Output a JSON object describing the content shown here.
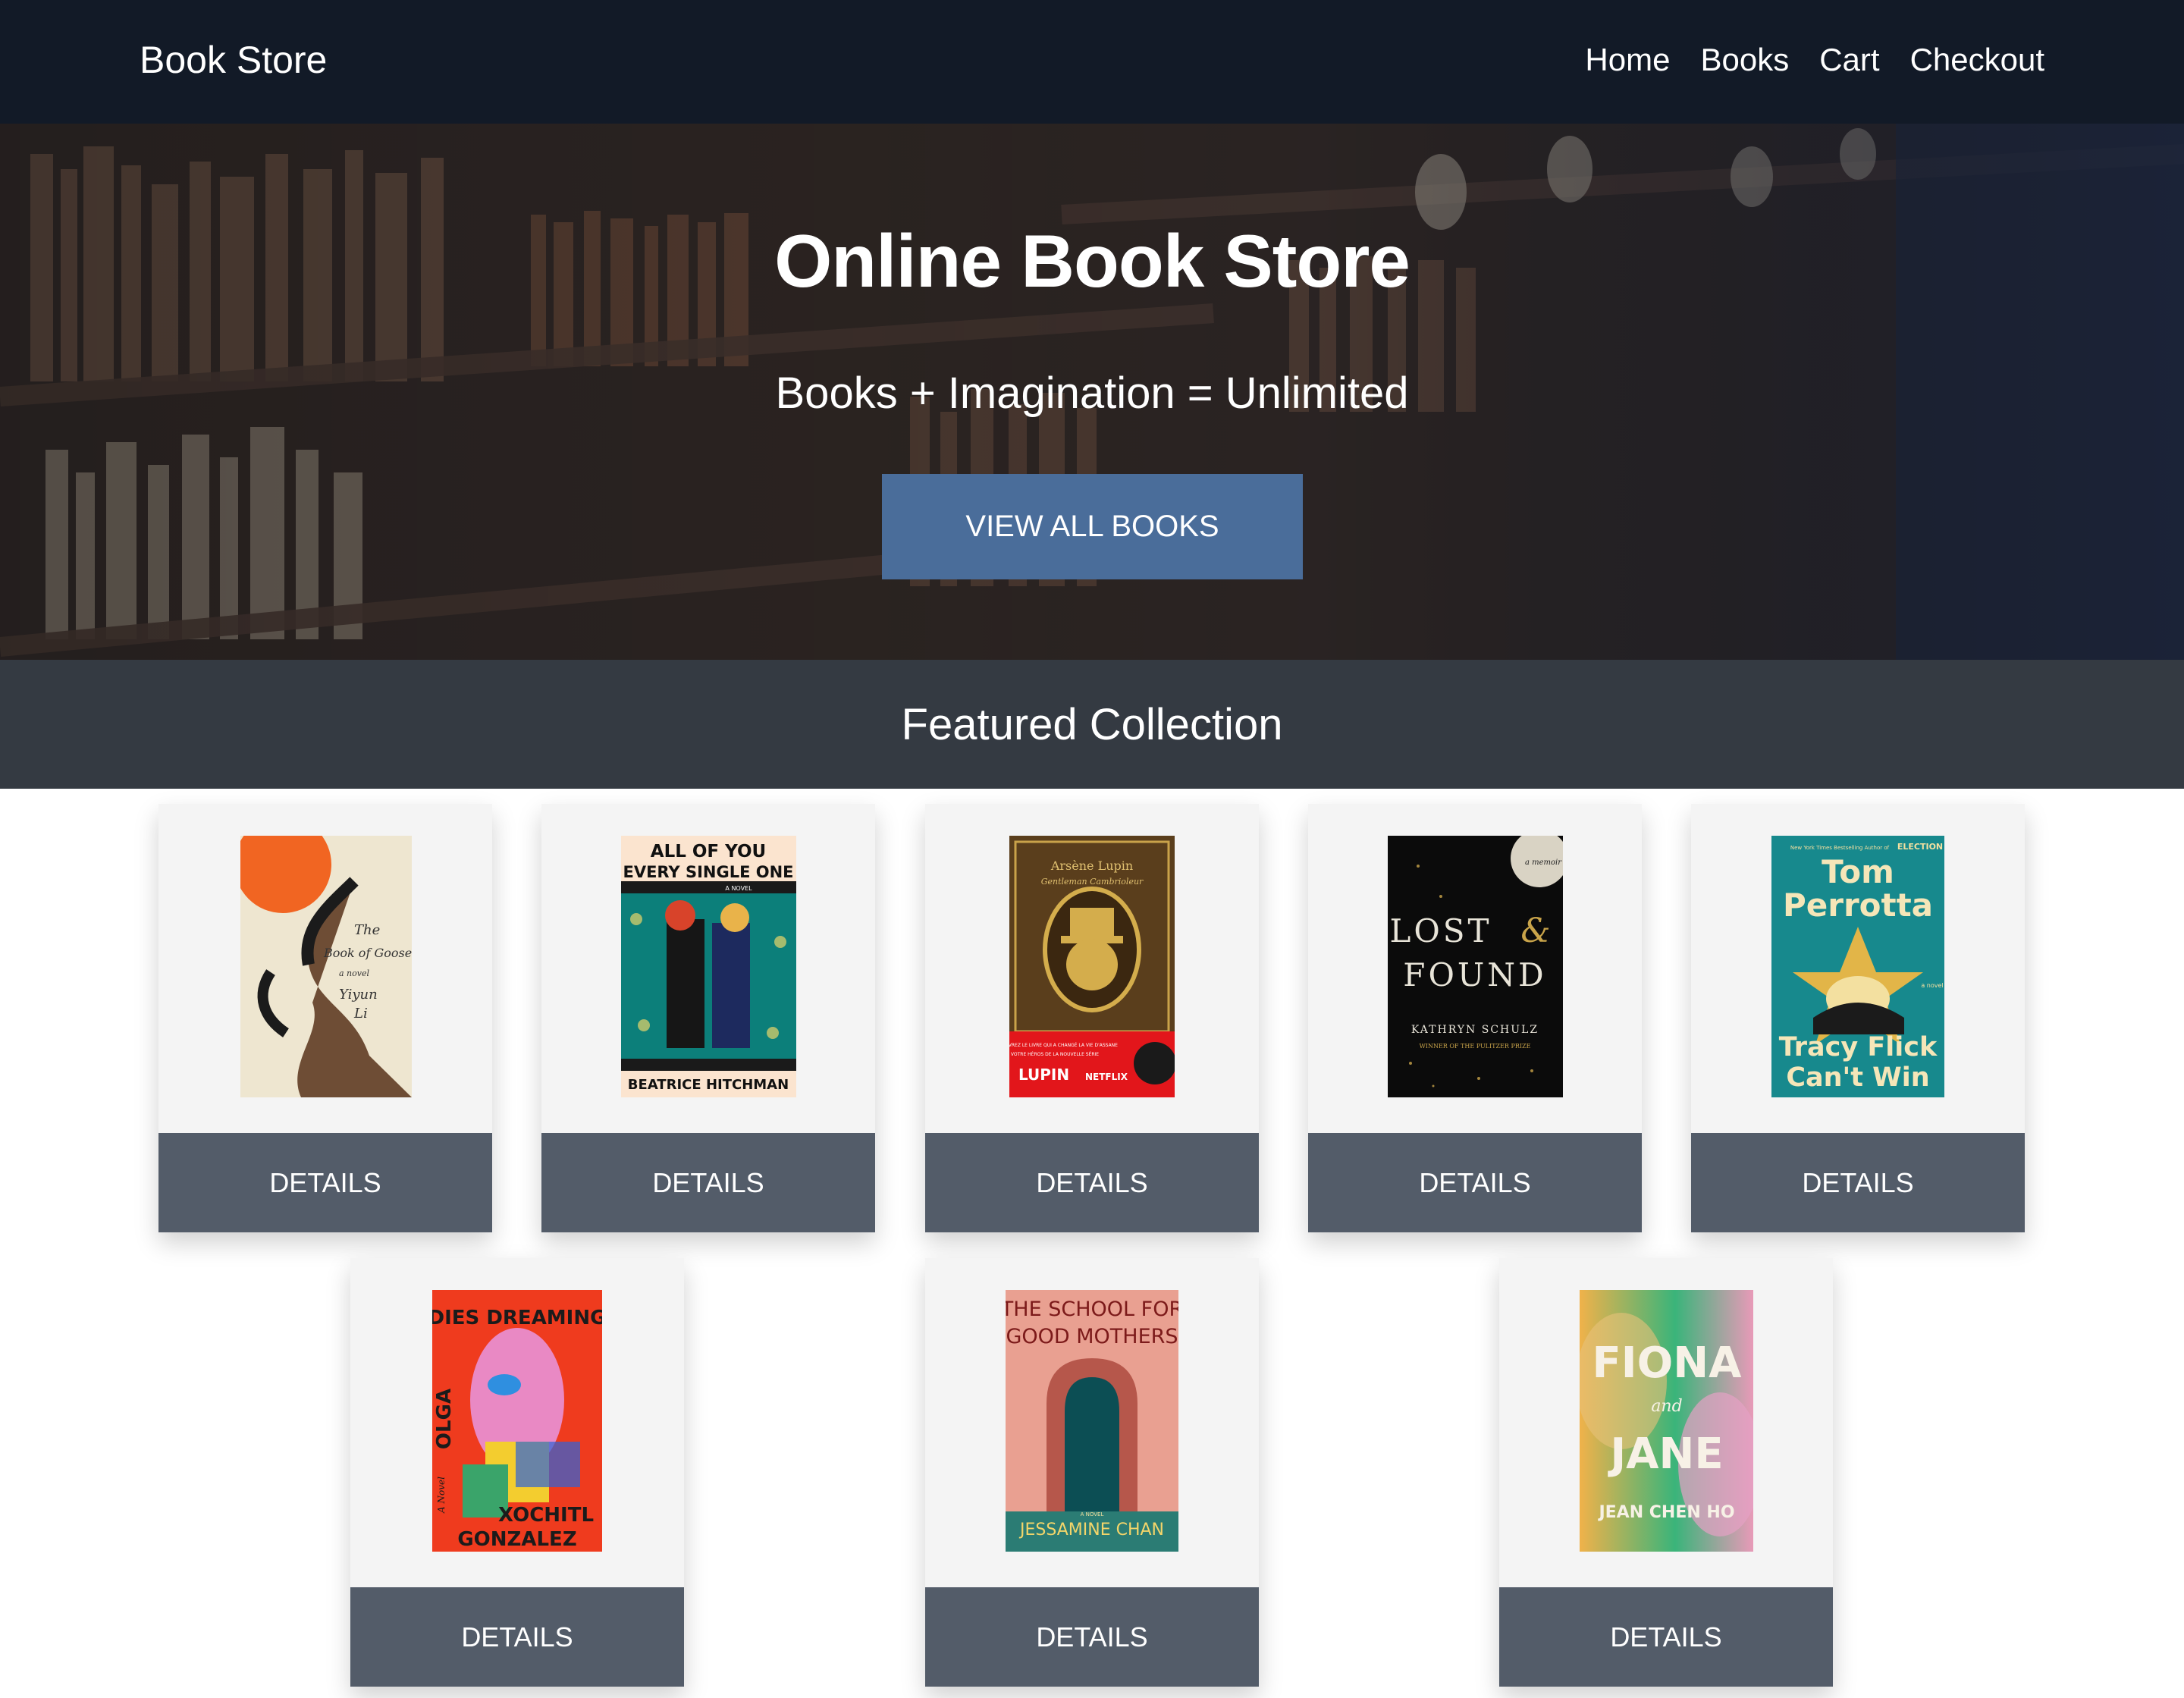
{
  "navbar": {
    "brand": "Book Store",
    "links": [
      "Home",
      "Books",
      "Cart",
      "Checkout"
    ]
  },
  "hero": {
    "title": "Online Book Store",
    "subtitle": "Books + Imagination = Unlimited",
    "button_label": "VIEW ALL BOOKS"
  },
  "featured": {
    "title": "Featured Collection"
  },
  "books": [
    {
      "cover_lines": [
        "The",
        "Book of Goose",
        "a novel",
        "Yiyun",
        "Li"
      ],
      "details_label": "DETAILS"
    },
    {
      "cover_lines": [
        "ALL OF YOU",
        "EVERY SINGLE ONE",
        "A NOVEL",
        "BEATRICE HITCHMAN"
      ],
      "details_label": "DETAILS"
    },
    {
      "cover_lines": [
        "Arsène Lupin",
        "Gentleman Cambrioleur",
        "DÉCOUVREZ LE LIVRE QUI A CHANGÉ LA VIE D'ASSANE",
        "VOTRE HÉROS DE LA NOUVELLE SÉRIE",
        "LUPIN",
        "NETFLIX"
      ],
      "details_label": "DETAILS"
    },
    {
      "cover_lines": [
        "a memoir",
        "LOST",
        "&",
        "FOUND",
        "KATHRYN SCHULZ",
        "WINNER OF THE PULITZER PRIZE"
      ],
      "details_label": "DETAILS"
    },
    {
      "cover_lines": [
        "New York Times Bestselling Author of",
        "ELECTION",
        "Tom",
        "Perrotta",
        "a novel",
        "Tracy Flick",
        "Can't Win"
      ],
      "details_label": "DETAILS"
    },
    {
      "cover_lines": [
        "OLGA",
        "DIES DREAMING",
        "A Novel",
        "XOCHITL",
        "GONZALEZ"
      ],
      "details_label": "DETAILS"
    },
    {
      "cover_lines": [
        "THE SCHOOL FOR",
        "GOOD MOTHERS",
        "A NOVEL",
        "JESSAMINE CHAN"
      ],
      "details_label": "DETAILS"
    },
    {
      "cover_lines": [
        "FIONA",
        "and",
        "JANE",
        "JEAN CHEN HO"
      ],
      "details_label": "DETAILS"
    }
  ],
  "colors": {
    "navbar_bg": "#121a27",
    "hero_button": "#4a6d9a",
    "featured_bar": "#343a42",
    "card_bg": "#f4f4f4",
    "details_button": "#535c69"
  }
}
